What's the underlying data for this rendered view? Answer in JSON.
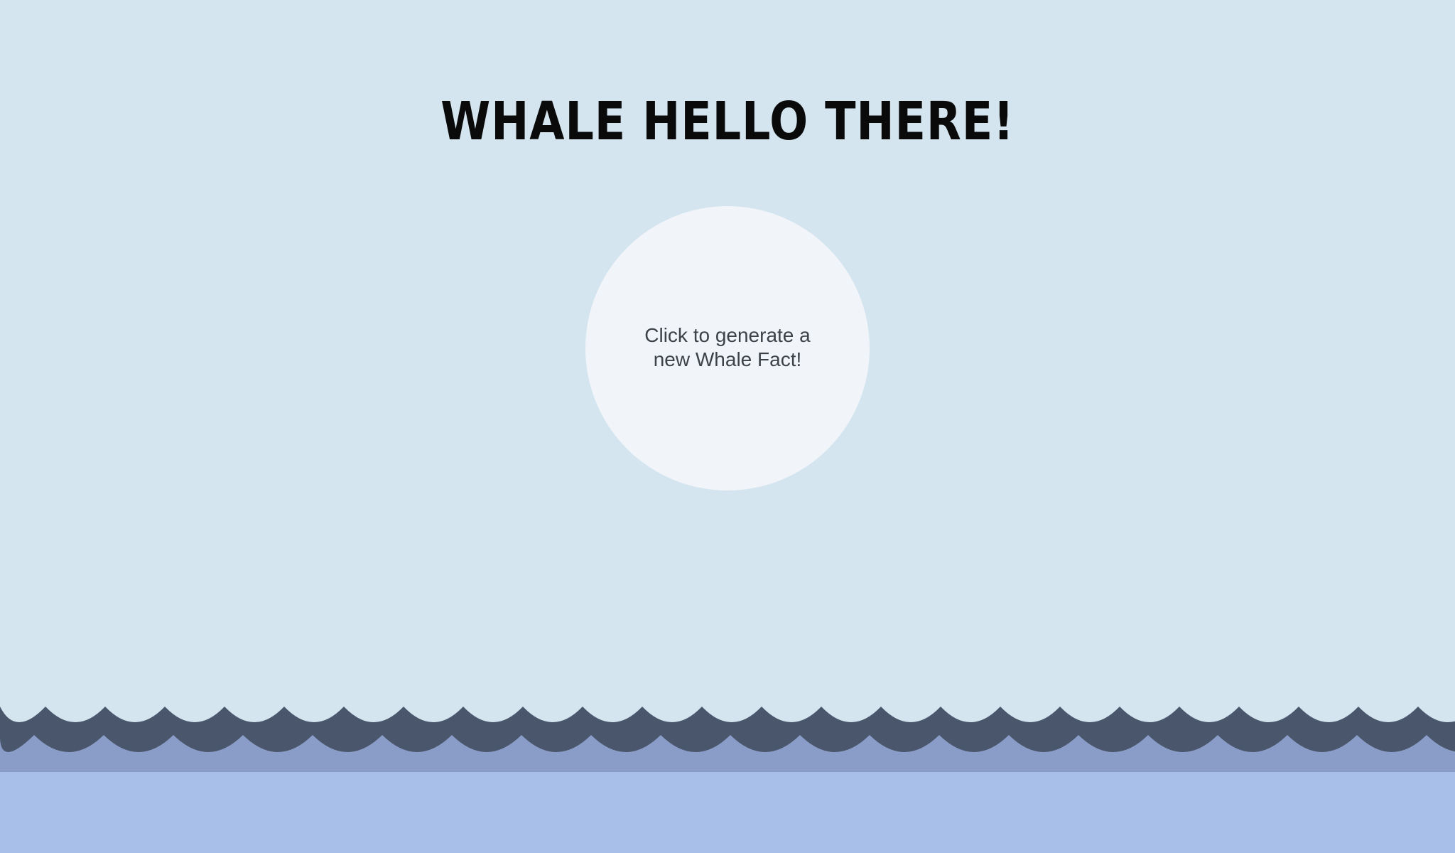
{
  "header": {
    "title": "WHALE HELLO THERE!"
  },
  "fact_button": {
    "label": "Click to generate a new Whale Fact!"
  },
  "colors": {
    "background": "#d4e5ef",
    "button": "#f1f5f9",
    "title": "#0a0a0a",
    "button_text": "#3c4248",
    "wave_back": "#4a566b",
    "wave_mid": "#8a9dc8",
    "wave_front": "#a8bfea"
  }
}
